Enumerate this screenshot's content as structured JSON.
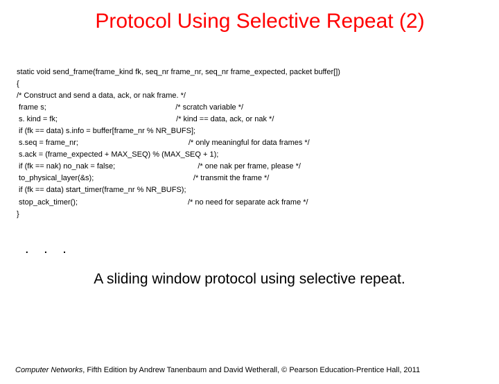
{
  "title": "Protocol Using Selective Repeat (2)",
  "code": {
    "line01": "static void send_frame(frame_kind fk, seq_nr frame_nr, seq_nr frame_expected, packet buffer[])",
    "line02": "{",
    "line03": "/* Construct and send a data, ack, or nak frame. */",
    "line04": " frame s;                                                             /* scratch variable */",
    "line05": "",
    "line06": " s. kind = fk;                                                        /* kind == data, ack, or nak */",
    "line07": " if (fk == data) s.info = buffer[frame_nr % NR_BUFS];",
    "line08": " s.seq = frame_nr;                                                    /* only meaningful for data frames */",
    "line09": " s.ack = (frame_expected + MAX_SEQ) % (MAX_SEQ + 1);",
    "line10": " if (fk == nak) no_nak = false;                                       /* one nak per frame, please */",
    "line11": " to_physical_layer(&s);                                               /* transmit the frame */",
    "line12": " if (fk == data) start_timer(frame_nr % NR_BUFS);",
    "line13": " stop_ack_timer();                                                    /* no need for separate ack frame */",
    "line14": "}"
  },
  "ellipsis": ". . .",
  "caption": "A sliding window protocol using selective repeat.",
  "footer_italic": "Computer Networks",
  "footer_rest": ", Fifth Edition by Andrew Tanenbaum and David Wetherall, © Pearson Education-Prentice Hall, 2011"
}
